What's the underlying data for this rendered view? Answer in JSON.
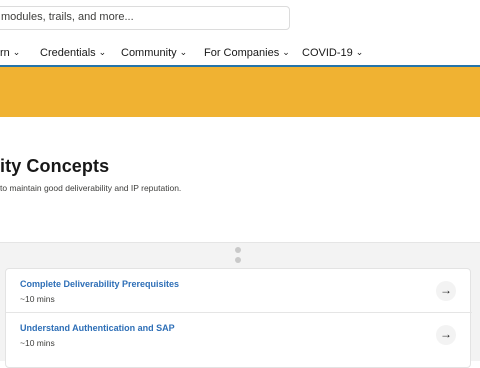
{
  "search": {
    "placeholder": "modules, trails, and more..."
  },
  "nav": {
    "items": [
      {
        "label": "rn"
      },
      {
        "label": "Credentials"
      },
      {
        "label": "Community"
      },
      {
        "label": "For Companies"
      },
      {
        "label": "COVID-19"
      }
    ]
  },
  "page": {
    "title": "ity Concepts",
    "subtitle": " to maintain good deliverability and IP reputation."
  },
  "units": [
    {
      "title": "Complete Deliverability Prerequisites",
      "time": "~10 mins"
    },
    {
      "title": "Understand Authentication and SAP",
      "time": "~10 mins"
    }
  ],
  "colors": {
    "banner": "#f0b232",
    "accent": "#2574a9",
    "link": "#2e6fb7"
  },
  "icons": {
    "chevron": "chevron-down-icon",
    "arrow": "arrow-right-icon",
    "handle": "drag-handle-icon"
  }
}
